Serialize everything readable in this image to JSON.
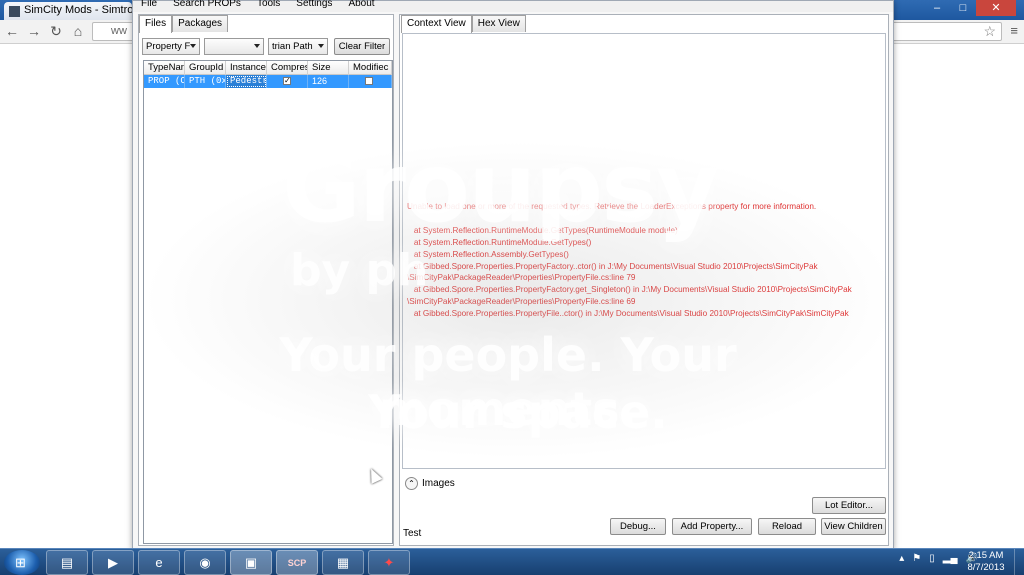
{
  "browser": {
    "tab_title": "SimCity Mods - Simtropo",
    "address": "ww",
    "window_buttons": [
      "–",
      "□",
      "✕"
    ]
  },
  "app": {
    "menu": [
      "File",
      "Search PROPs",
      "Tools",
      "Settings",
      "About"
    ],
    "left_tabs": [
      "Files",
      "Packages"
    ],
    "filters": {
      "type_combo": "Property F",
      "group_combo": "",
      "instance_combo": "trian Path",
      "clear_button": "Clear Filter"
    },
    "grid": {
      "columns": [
        "TypeNar",
        "GroupId",
        "Instancel",
        "Compres",
        "Size",
        "Modifiec"
      ],
      "rows": [
        {
          "type": "PROP (C",
          "group": "PTH (0x",
          "instance": "Pedestr",
          "compressed": true,
          "size": "126",
          "modified": false
        }
      ]
    },
    "right_tabs": [
      "Context View",
      "Hex View"
    ],
    "error_text": "Unable to load one or more of the requested types. Retrieve the LoaderExceptions property for more information.\n\n   at System.Reflection.RuntimeModule.GetTypes(RuntimeModule module)\n   at System.Reflection.RuntimeModule.GetTypes()\n   at System.Reflection.Assembly.GetTypes()\n   at Gibbed.Spore.Properties.PropertyFactory..ctor() in J:\\My Documents\\Visual Studio 2010\\Projects\\SimCityPak\n\\SimCityPak\\PackageReader\\Properties\\PropertyFile.cs:line 79\n   at Gibbed.Spore.Properties.PropertyFactory.get_Singleton() in J:\\My Documents\\Visual Studio 2010\\Projects\\SimCityPak\n\\SimCityPak\\PackageReader\\Properties\\PropertyFile.cs:line 69\n   at Gibbed.Spore.Properties.PropertyFile..ctor() in J:\\My Documents\\Visual Studio 2010\\Projects\\SimCityPak\\SimCityPak",
    "images_label": "Images",
    "test_label": "Test",
    "buttons": {
      "lot_editor": "Lot Editor...",
      "debug": "Debug...",
      "add_property": "Add Property...",
      "reload": "Reload",
      "view_children": "View Children"
    }
  },
  "watermark": {
    "logo": "Groupsy",
    "by": "by ph",
    "line1": "Your people. Your moments.",
    "line2": "Your space."
  },
  "taskbar": {
    "time": "2:15 AM",
    "date": "8/7/2013",
    "items": [
      "folder-icon",
      "media-player-icon",
      "ie-icon",
      "chrome-icon",
      "app-icon",
      "scp-icon",
      "film-icon",
      "red-app-icon"
    ],
    "scp_label": "SCP"
  },
  "colors": {
    "error_text": "#e03030",
    "selection": "#3399ff",
    "taskbar": "#1e4a80"
  }
}
